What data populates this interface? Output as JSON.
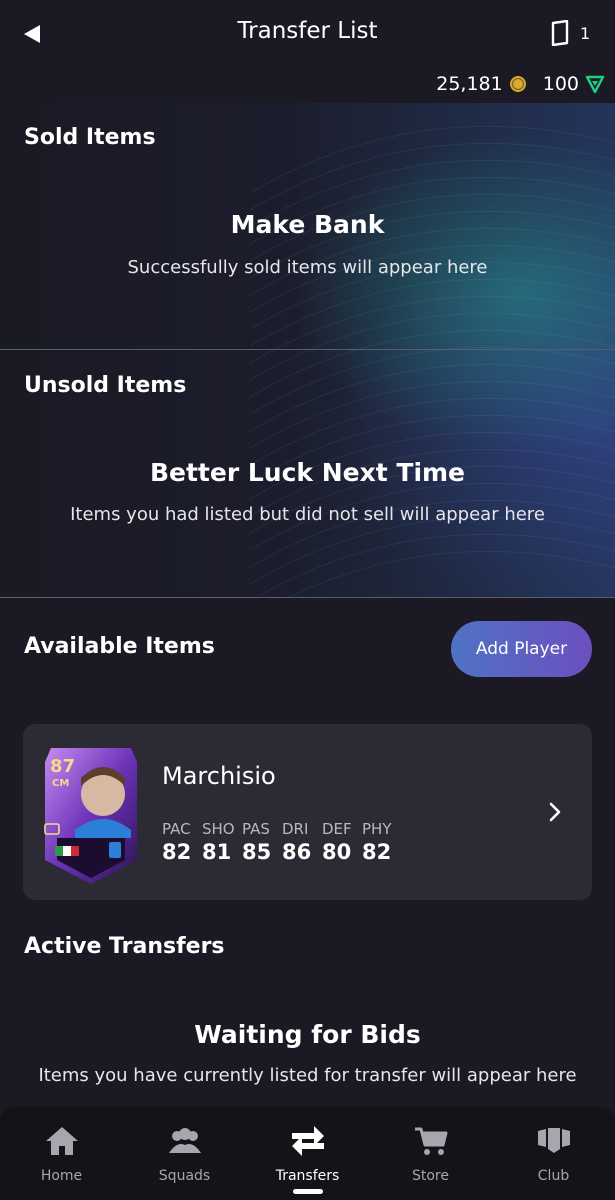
{
  "header": {
    "title": "Transfer List",
    "back_icon": "back-arrow-icon",
    "pack_icon": "pack-icon",
    "pack_count": "1",
    "coins": "25,181",
    "coin_icon": "coin-icon",
    "points": "100",
    "points_icon": "fifa-points-icon"
  },
  "sold": {
    "heading": "Sold Items",
    "empty_title": "Make Bank",
    "empty_text": "Successfully sold items will appear here"
  },
  "unsold": {
    "heading": "Unsold Items",
    "empty_title": "Better Luck Next Time",
    "empty_text": "Items you had listed but did not sell will appear here"
  },
  "available": {
    "heading": "Available Items",
    "add_button": "Add Player",
    "player": {
      "rating": "87",
      "position": "CM",
      "name": "Marchisio",
      "stats": [
        {
          "label": "PAC",
          "value": "82"
        },
        {
          "label": "SHO",
          "value": "81"
        },
        {
          "label": "PAS",
          "value": "85"
        },
        {
          "label": "DRI",
          "value": "86"
        },
        {
          "label": "DEF",
          "value": "80"
        },
        {
          "label": "PHY",
          "value": "82"
        }
      ]
    }
  },
  "active": {
    "heading": "Active Transfers",
    "empty_title": "Waiting for Bids",
    "empty_text": "Items you have currently listed for transfer will appear here"
  },
  "nav": {
    "items": [
      {
        "label": "Home",
        "icon": "home-icon"
      },
      {
        "label": "Squads",
        "icon": "squads-icon"
      },
      {
        "label": "Transfers",
        "icon": "transfers-icon",
        "active": true
      },
      {
        "label": "Store",
        "icon": "cart-icon"
      },
      {
        "label": "Club",
        "icon": "club-icon"
      }
    ]
  },
  "colors": {
    "background": "#1b1a24",
    "card": "#2c2b35",
    "button_gradient_start": "#4f73c4",
    "button_gradient_end": "#6c4fc0",
    "coin": "#d7a937",
    "points": "#1bd17e"
  }
}
